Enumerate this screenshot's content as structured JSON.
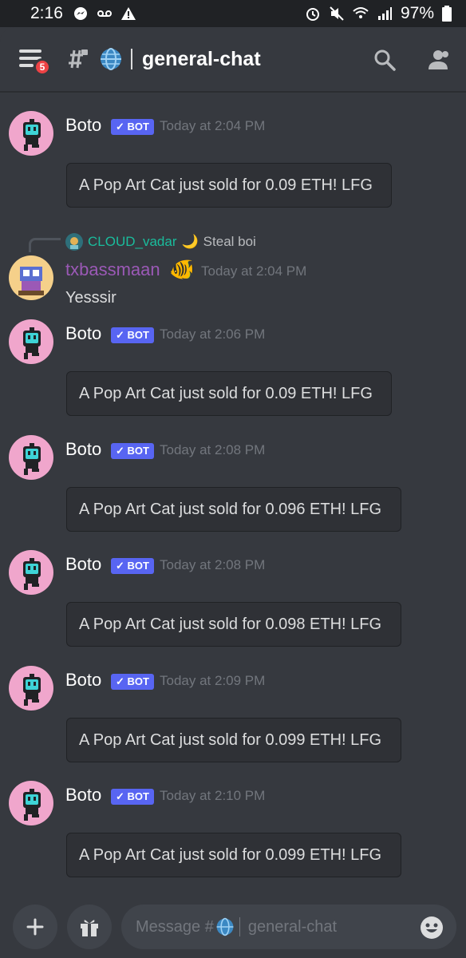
{
  "status_bar": {
    "time": "2:16",
    "battery": "97%"
  },
  "header": {
    "badge_count": "5",
    "channel_name": "general-chat"
  },
  "messages": [
    {
      "author": "Boto",
      "bot_tag": "✓ BOT",
      "timestamp": "Today at 2:04 PM",
      "embed": "A Pop Art Cat just sold for 0.09 ETH! LFG"
    },
    {
      "reply_to": "CLOUD_vadar",
      "reply_emoji": "🌙",
      "reply_text": "Steal boi",
      "author": "txbassmaan",
      "author_emoji": "🐠",
      "timestamp": "Today at 2:04 PM",
      "text": "Yesssir"
    },
    {
      "author": "Boto",
      "bot_tag": "✓ BOT",
      "timestamp": "Today at 2:06 PM",
      "embed": "A Pop Art Cat just sold for 0.09 ETH! LFG"
    },
    {
      "author": "Boto",
      "bot_tag": "✓ BOT",
      "timestamp": "Today at 2:08 PM",
      "embed": "A Pop Art Cat just sold for 0.096 ETH! LFG"
    },
    {
      "author": "Boto",
      "bot_tag": "✓ BOT",
      "timestamp": "Today at 2:08 PM",
      "embed": "A Pop Art Cat just sold for 0.098 ETH! LFG"
    },
    {
      "author": "Boto",
      "bot_tag": "✓ BOT",
      "timestamp": "Today at 2:09 PM",
      "embed": "A Pop Art Cat just sold for 0.099 ETH! LFG"
    },
    {
      "author": "Boto",
      "bot_tag": "✓ BOT",
      "timestamp": "Today at 2:10 PM",
      "embed": "A Pop Art Cat just sold for 0.099 ETH! LFG"
    }
  ],
  "composer": {
    "placeholder_prefix": "Message #",
    "placeholder_channel": "general-chat"
  },
  "colors": {
    "background": "#36393f",
    "bot_tag": "#5865f2",
    "badge": "#ed4245",
    "reply_name": "#1abc9c",
    "txbassmaan_name": "#9b59b6"
  }
}
